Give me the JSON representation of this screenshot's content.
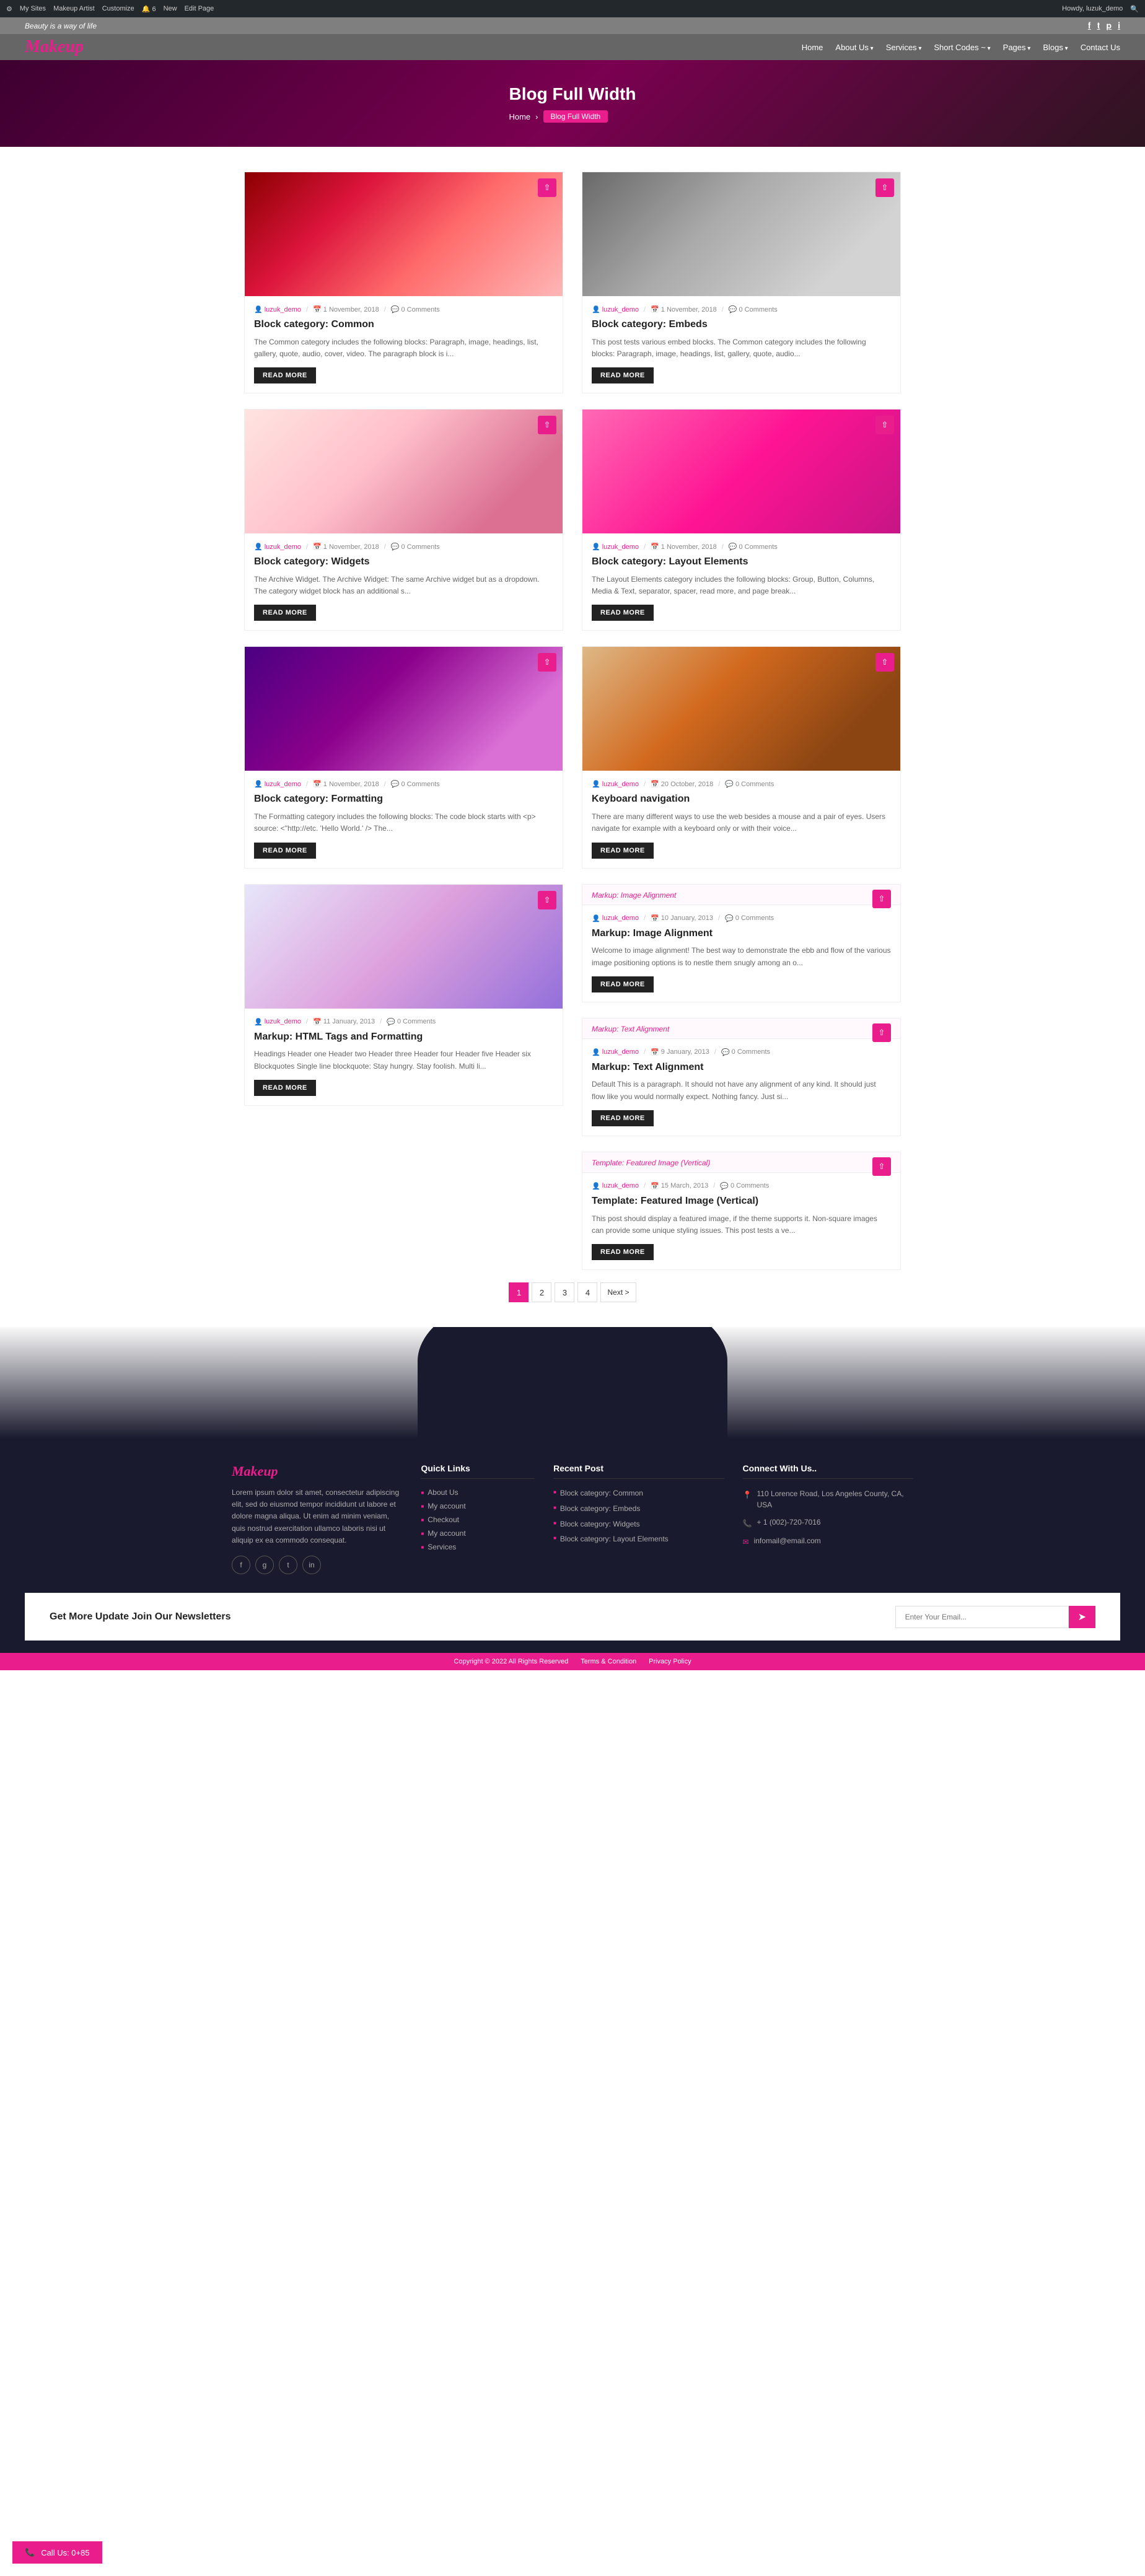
{
  "adminBar": {
    "mySites": "My Sites",
    "makeupArtist": "Makeup Artist",
    "customize": "Customize",
    "newCount": "6",
    "new": "New",
    "editPage": "Edit Page",
    "howdy": "Howdy, luzuk_demo"
  },
  "topBar": {
    "tagline": "Beauty is a way of life",
    "socialIcons": [
      "f",
      "t",
      "p",
      "i"
    ]
  },
  "logo": "Makeup",
  "nav": {
    "items": [
      {
        "label": "Home",
        "hasDropdown": false
      },
      {
        "label": "About Us",
        "hasDropdown": true
      },
      {
        "label": "Services",
        "hasDropdown": true
      },
      {
        "label": "Short Codes ~",
        "hasDropdown": true
      },
      {
        "label": "Pages",
        "hasDropdown": true
      },
      {
        "label": "Blogs",
        "hasDropdown": true
      },
      {
        "label": "Contact Us",
        "hasDropdown": false
      }
    ]
  },
  "hero": {
    "title": "Blog Full Width",
    "breadcrumb": {
      "home": "Home",
      "current": "Blog Full Width"
    }
  },
  "posts": [
    {
      "id": 1,
      "imgClass": "img-nail-red",
      "author": "luzuk_demo",
      "date": "1 November, 2018",
      "comments": "0 Comments",
      "title": "Block category: Common",
      "excerpt": "The Common category includes the following blocks: Paragraph, image, headings, list, gallery, quote, audio, cover, video. The paragraph block is i...",
      "readMore": "READ MORE"
    },
    {
      "id": 2,
      "imgClass": "img-makeup-artist",
      "author": "luzuk_demo",
      "date": "1 November, 2018",
      "comments": "0 Comments",
      "title": "Block category: Embeds",
      "excerpt": "This post tests various embed blocks. The Common category includes the following blocks: Paragraph, image, headings, list, gallery, quote, audio...",
      "readMore": "READ MORE"
    },
    {
      "id": 3,
      "imgClass": "img-nail-gel",
      "author": "luzuk_demo",
      "date": "1 November, 2018",
      "comments": "0 Comments",
      "title": "Block category: Widgets",
      "excerpt": "The Archive Widget. The Archive Widget: The same Archive widget but as a dropdown. The category widget block has an additional s...",
      "readMore": "READ MORE"
    },
    {
      "id": 4,
      "imgClass": "img-woman-pink",
      "author": "luzuk_demo",
      "date": "1 November, 2018",
      "comments": "0 Comments",
      "title": "Block category: Layout Elements",
      "excerpt": "The Layout Elements category includes the following blocks: Group, Button, Columns, Media & Text, separator, spacer, read more, and page break...",
      "readMore": "READ MORE"
    },
    {
      "id": 5,
      "imgClass": "img-woman-flowers",
      "author": "luzuk_demo",
      "date": "1 November, 2018",
      "comments": "0 Comments",
      "title": "Block category: Formatting",
      "excerpt": "The Formatting category includes the following blocks: The code block starts with <p> source: <\"http://etc. 'Hello World.' />  The...",
      "readMore": "READ MORE"
    },
    {
      "id": 6,
      "imgClass": "img-mirror-woman",
      "author": "luzuk_demo",
      "date": "20 October, 2018",
      "comments": "0 Comments",
      "title": "Keyboard navigation",
      "excerpt": "There are many different ways to use the web besides a mouse and a pair of eyes. Users navigate for example with a keyboard only or with their voice...",
      "readMore": "READ MORE"
    },
    {
      "id": 7,
      "imgClass": "img-feet",
      "author": "luzuk_demo",
      "date": "11 January, 2013",
      "comments": "0 Comments",
      "title": "Markup: HTML Tags and Formatting",
      "excerpt": "Headings Header one Header two Header three Header four Header five Header six Blockquotes Single line blockquote: Stay hungry. Stay foolish. Multi li...",
      "readMore": "READ MORE"
    }
  ],
  "rightPosts": [
    {
      "id": 8,
      "miniLabel": "Markup: Image Alignment",
      "author": "luzuk_demo",
      "date": "10 January, 2013",
      "comments": "0 Comments",
      "title": "Markup: Image Alignment",
      "excerpt": "Welcome to image alignment! The best way to demonstrate the ebb and flow of the various image positioning options is to nestle them snugly among an o...",
      "readMore": "READ MORE"
    },
    {
      "id": 9,
      "miniLabel": "Markup: Text Alignment",
      "author": "luzuk_demo",
      "date": "9 January, 2013",
      "comments": "0 Comments",
      "title": "Markup: Text Alignment",
      "excerpt": "Default This is a paragraph. It should not have any alignment of any kind. It should just flow like you would normally expect. Nothing fancy. Just si...",
      "readMore": "READ MORE"
    },
    {
      "id": 10,
      "miniLabel": "Template: Featured Image (Vertical)",
      "author": "luzuk_demo",
      "date": "15 March, 2013",
      "comments": "0 Comments",
      "title": "Template: Featured Image (Vertical)",
      "excerpt": "This post should display a featured image, if the theme supports it. Non-square images can provide some unique styling issues. This post tests a ve...",
      "readMore": "READ MORE"
    }
  ],
  "pagination": {
    "pages": [
      "1",
      "2",
      "3",
      "4"
    ],
    "next": "Next >"
  },
  "footer": {
    "logo": "Makeup",
    "desc": "Lorem ipsum dolor sit amet, consectetur adipiscing elit, sed do eiusmod tempor incididunt ut labore et dolore magna aliqua. Ut enim ad minim veniam, quis nostrud exercitation ullamco laboris nisi ut aliquip ex ea commodo consequat.",
    "socialIcons": [
      "f",
      "g",
      "t",
      "in"
    ],
    "quickLinks": {
      "title": "Quick Links",
      "items": [
        {
          "label": "About Us"
        },
        {
          "label": "My account"
        },
        {
          "label": "Checkout"
        },
        {
          "label": "My account"
        },
        {
          "label": "Services"
        }
      ]
    },
    "recentPost": {
      "title": "Recent Post",
      "items": [
        {
          "label": "Block category: Common"
        },
        {
          "label": "Block category: Embeds"
        },
        {
          "label": "Block category: Widgets"
        },
        {
          "label": "Block category: Layout Elements"
        }
      ]
    },
    "connect": {
      "title": "Connect With Us..",
      "address": "110 Lorence Road, Los Angeles County, CA, USA",
      "phone": "+ 1 (002)-720-7016",
      "email": "infomail@email.com"
    }
  },
  "newsletter": {
    "title": "Get More Update Join Our Newsletters",
    "placeholder": "Enter Your Email...",
    "btnIcon": "➤"
  },
  "bottomBar": {
    "copyright": "Copyright © 2022 All Rights Reserved",
    "terms": "Terms & Condition",
    "privacy": "Privacy Policy"
  },
  "phoneCta": {
    "icon": "📞",
    "text": "Call Us: 0+85"
  }
}
